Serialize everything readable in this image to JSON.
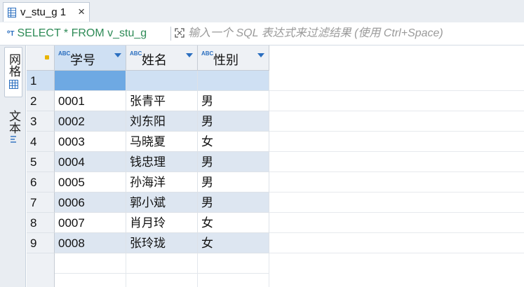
{
  "tab": {
    "title": "v_stu_g 1",
    "close": "×"
  },
  "filter": {
    "sql": "SELECT * FROM v_stu_g",
    "placeholder": "输入一个 SQL 表达式来过滤结果 (使用 Ctrl+Space)"
  },
  "side": {
    "grid_label": "网格",
    "text_label": "文本"
  },
  "columns": [
    {
      "type": "ABC",
      "label": "学号"
    },
    {
      "type": "ABC",
      "label": "姓名"
    },
    {
      "type": "ABC",
      "label": "性别"
    }
  ],
  "rows": [
    {
      "n": "1",
      "c": [
        "",
        "",
        ""
      ]
    },
    {
      "n": "2",
      "c": [
        "0001",
        "张青平",
        "男"
      ]
    },
    {
      "n": "3",
      "c": [
        "0002",
        "刘东阳",
        "男"
      ]
    },
    {
      "n": "4",
      "c": [
        "0003",
        "马晓夏",
        "女"
      ]
    },
    {
      "n": "5",
      "c": [
        "0004",
        "钱忠理",
        "男"
      ]
    },
    {
      "n": "6",
      "c": [
        "0005",
        "孙海洋",
        "男"
      ]
    },
    {
      "n": "7",
      "c": [
        "0006",
        "郭小斌",
        "男"
      ]
    },
    {
      "n": "8",
      "c": [
        "0007",
        "肖月玲",
        "女"
      ]
    },
    {
      "n": "9",
      "c": [
        "0008",
        "张玲珑",
        "女"
      ]
    }
  ],
  "colors": {
    "accent": "#2a6ebf",
    "sql_text": "#2e8b57",
    "selected_cell": "#6ea9e3",
    "alt_row": "#dde6f1"
  }
}
